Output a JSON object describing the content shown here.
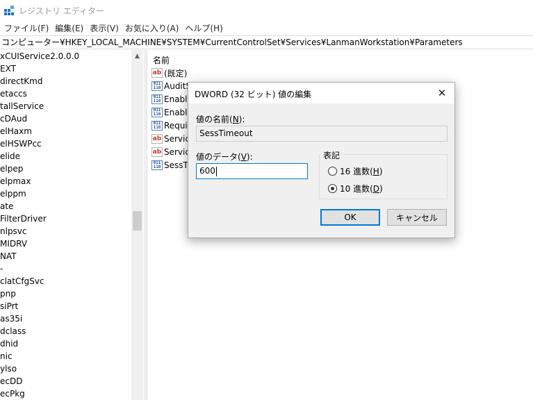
{
  "window": {
    "title": "レジストリ エディター"
  },
  "menu": [
    "ファイル(F)",
    "編集(E)",
    "表示(V)",
    "お気に入り(A)",
    "ヘルプ(H)"
  ],
  "address": "コンピューター¥HKEY_LOCAL_MACHINE¥SYSTEM¥CurrentControlSet¥Services¥LanmanWorkstation¥Parameters",
  "tree": [
    "xCUIService2.0.0.0",
    "EXT",
    "directKmd",
    "etaccs",
    "tallService",
    "cDAud",
    "elHaxm",
    "elHSWPcc",
    "elide",
    "elpep",
    "elpmax",
    "elppm",
    "ate",
    "FilterDriver",
    "nlpsvc",
    "MIDRV",
    "NAT",
    "-",
    "clatCfgSvc",
    "pnp",
    "siPrt",
    "as35i",
    "dclass",
    "dhid",
    "nic",
    "ylso",
    "ecDD",
    "ecPkg"
  ],
  "list": {
    "header": "名前",
    "rows": [
      {
        "icon": "string-value-icon",
        "name": "(既定)"
      },
      {
        "icon": "binary-value-icon",
        "name": "AuditS"
      },
      {
        "icon": "binary-value-icon",
        "name": "Enable"
      },
      {
        "icon": "binary-value-icon",
        "name": "Enable"
      },
      {
        "icon": "binary-value-icon",
        "name": "Requir"
      },
      {
        "icon": "string-value-icon",
        "name": "Service"
      },
      {
        "icon": "string-value-icon",
        "name": "Service"
      },
      {
        "icon": "binary-value-icon",
        "name": "SessTi"
      }
    ]
  },
  "dialog": {
    "title": "DWORD (32 ビット) 値の編集",
    "name_label_pre": "値の名前(",
    "name_label_key": "N",
    "name_label_post": "):",
    "name_value": "SessTimeout",
    "data_label_pre": "値のデータ(",
    "data_label_key": "V",
    "data_label_post": "):",
    "data_value": "600",
    "base_label": "表記",
    "hex_pre": "16 進数(",
    "hex_key": "H",
    "hex_post": ")",
    "dec_pre": "10 進数(",
    "dec_key": "D",
    "dec_post": ")",
    "selected_base": "dec",
    "ok": "OK",
    "cancel": "キャンセル"
  }
}
